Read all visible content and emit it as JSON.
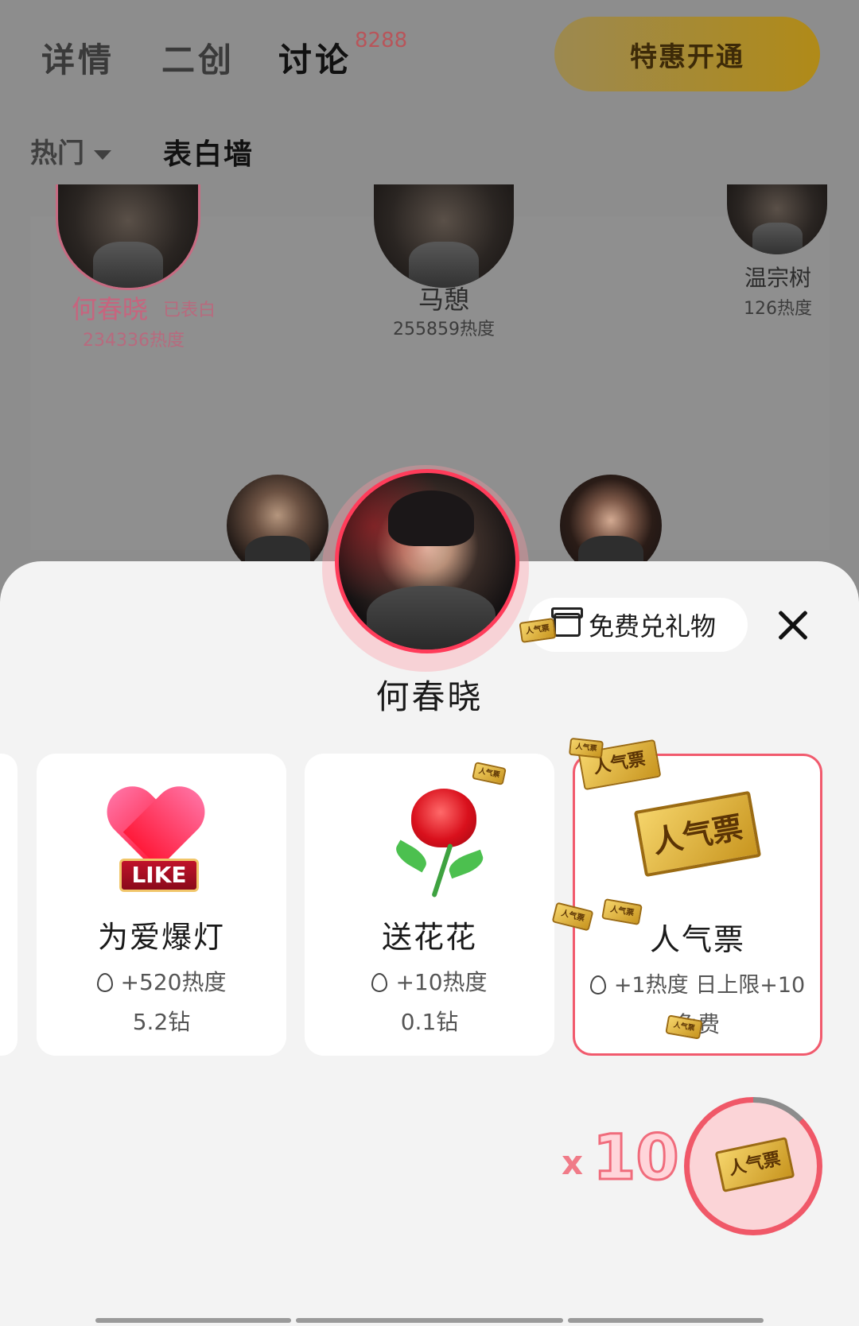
{
  "tabs": [
    {
      "label": "详情"
    },
    {
      "label": "二创"
    },
    {
      "label": "讨论",
      "badge": "8288"
    }
  ],
  "vip_button": "特惠开通",
  "sub_nav": {
    "hot": "热门",
    "wall": "表白墙"
  },
  "wall": [
    {
      "name": "何春晓",
      "tag": "已表白",
      "heat": "234336热度"
    },
    {
      "name": "马憩",
      "heat": "255859热度"
    },
    {
      "name": "温宗树",
      "heat": "126热度"
    }
  ],
  "selected_character": "何春晓",
  "free_gift_button": "免费兑礼物",
  "ticket_text": "人气票",
  "gifts": [
    {
      "name": "为爱爆灯",
      "heat": "+520热度",
      "price": "5.2钻",
      "badge": "LIKE"
    },
    {
      "name": "送花花",
      "heat": "+10热度",
      "price": "0.1钻"
    },
    {
      "name": "人气票",
      "heat": "+1热度 日上限+10",
      "price": "免费",
      "selected": true
    }
  ],
  "send": {
    "multiplier": "x",
    "count": "10",
    "progress": 0.87
  },
  "colors": {
    "accent": "#f15a6d",
    "gold": "#c8951f",
    "vip_bg": "#b08a18"
  }
}
